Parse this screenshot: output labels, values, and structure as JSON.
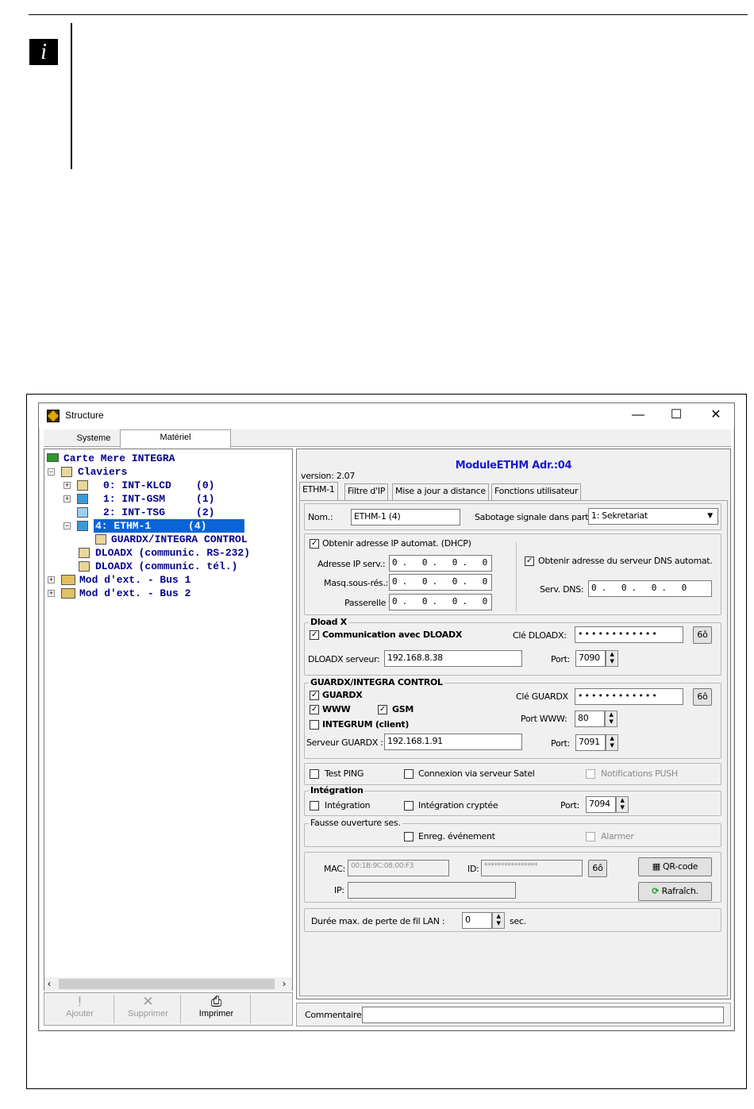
{
  "doc": {
    "info_icon": "info-icon",
    "info_letter": "i"
  },
  "window": {
    "title": "Structure",
    "minimize": "—",
    "maximize": "☐",
    "close": "✕"
  },
  "left_tabs": [
    "Systeme",
    "Matériel"
  ],
  "tree": {
    "root": "Carte Mere INTEGRA",
    "claviers": "Claviers",
    "kb0": "0: INT-KLCD    (0)",
    "kb1": "1: INT-GSM     (1)",
    "kb2": "2: INT-TSG     (2)",
    "kb4": "4: ETHM-1      (4)",
    "guardx": "GUARDX/INTEGRA CONTROL",
    "dload1": "DLOADX (communic. RS-232)",
    "dload2": "DLOADX (communic. tél.)",
    "bus1": "Mod d'ext. - Bus 1",
    "bus2": "Mod d'ext. - Bus 2"
  },
  "left_buttons": {
    "add": "Ajouter",
    "delete": "Supprimer",
    "print": "Imprimer"
  },
  "module": {
    "version": "version: 2.07",
    "title": "ModuleETHM Adr.:04"
  },
  "tabs": [
    "ETHM-1",
    "Filtre d'IP",
    "Mise a jour a distance",
    "Fonctions utilisateur"
  ],
  "name_row": {
    "label": "Nom.:",
    "value": "ETHM-1     (4)",
    "tamper_label": "Sabotage signale dans part.",
    "tamper_value": "1: Sekretariat"
  },
  "ip": {
    "dhcp_label": "Obtenir adresse IP automat. (DHCP)",
    "addr_label": "Adresse IP serv.:",
    "addr": "0. 0. 0. 0",
    "mask_label": "Masq.sous-rés.:",
    "mask": "0. 0. 0. 0",
    "gw_label": "Passerelle",
    "gw": "0. 0. 0. 0",
    "dns_auto_label": "Obtenir adresse du serveur DNS automat.",
    "dns_label": "Serv. DNS:",
    "dns": "0. 0. 0. 0"
  },
  "dload": {
    "title": "Dload X",
    "comm_label": "Communication avec DLOADX",
    "key_label": "Clé DLOADX:",
    "key": "••••••••••••",
    "server_label": "DLOADX serveur:",
    "server": "192.168.8.38",
    "port_label": "Port:",
    "port": "7090"
  },
  "guardx": {
    "title": "GUARDX/INTEGRA CONTROL",
    "guardx_label": "GUARDX",
    "www_label": "WWW",
    "gsm_label": "GSM",
    "integrum_label": "INTEGRUM (client)",
    "key_label": "Clé GUARDX",
    "key": "••••••••••••",
    "www_port_label": "Port WWW:",
    "www_port": "80",
    "server_label": "Serveur GUARDX :",
    "server": "192.168.1.91",
    "port_label": "Port:",
    "port": "7091"
  },
  "misc": {
    "ping": "Test PING",
    "satel": "Connexion via serveur Satel",
    "push": "Notifications PUSH"
  },
  "integration": {
    "title": "Intégration",
    "integ": "Intégration",
    "crypt": "Intégration cryptée",
    "port_label": "Port:",
    "port": "7094"
  },
  "fausse": {
    "title": "Fausse ouverture ses.",
    "enreg": "Enreg. événement",
    "alarm": "Alarmer"
  },
  "mac": {
    "mac_label": "MAC:",
    "mac": "00:1B:9C:08:00:F3",
    "id_label": "ID:",
    "id": "****************",
    "ip_label": "IP:",
    "ip": "",
    "qr": "QR-code",
    "refresh": "Rafraîch."
  },
  "lan": {
    "label": "Durée max. de perte de fil LAN :",
    "value": "0",
    "unit": "sec."
  },
  "comment": {
    "label": "Commentaire:",
    "value": ""
  },
  "show_icon": "6ô"
}
